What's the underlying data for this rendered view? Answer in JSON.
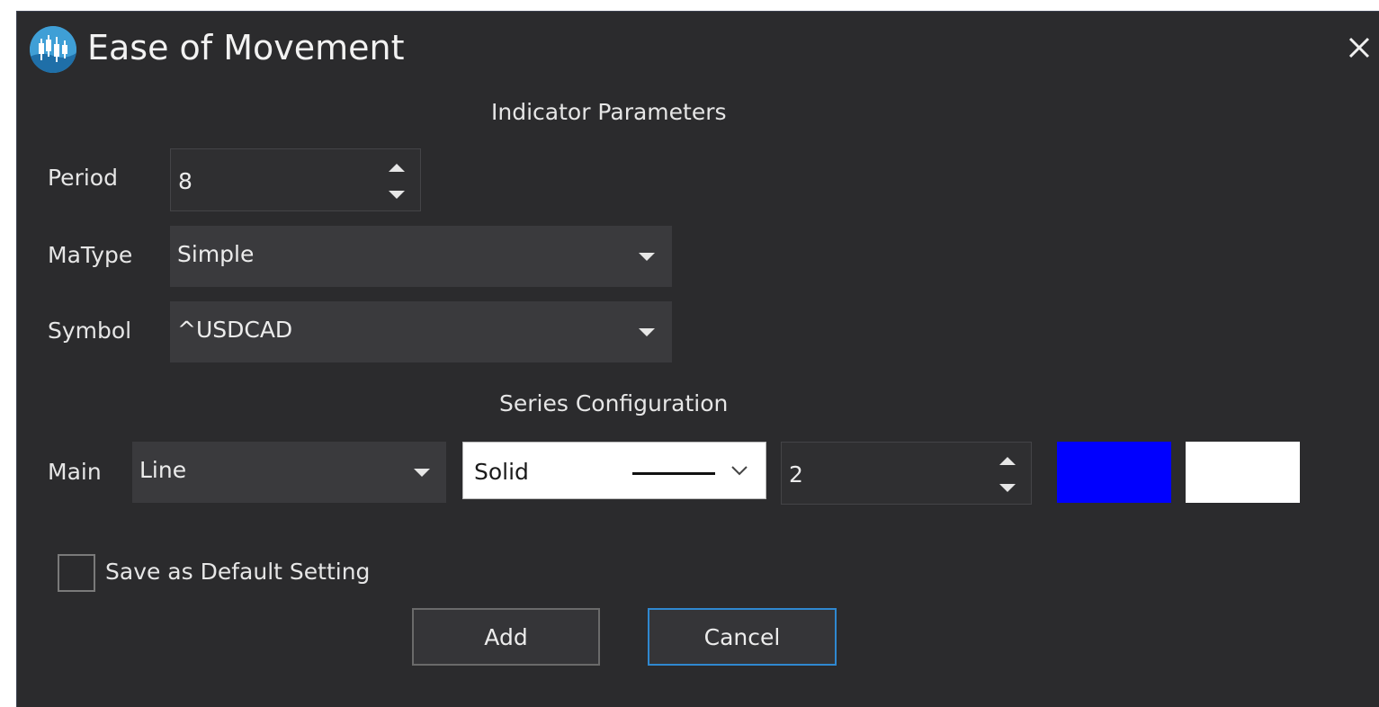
{
  "window": {
    "title": "Ease of Movement",
    "app_icon": "candlestick-chart-icon",
    "close_icon": "close-icon"
  },
  "indicator_parameters": {
    "heading": "Indicator Parameters",
    "period": {
      "label": "Period",
      "value": "8"
    },
    "ma_type": {
      "label": "MaType",
      "value": "Simple"
    },
    "symbol": {
      "label": "Symbol",
      "value": "^USDCAD"
    }
  },
  "series_configuration": {
    "heading": "Series Configuration",
    "main": {
      "label": "Main",
      "series_type": "Line",
      "line_style": "Solid",
      "line_width": "2",
      "color_primary": "#0000ff",
      "color_secondary": "#ffffff"
    }
  },
  "save_default": {
    "label": "Save as Default Setting",
    "checked": false
  },
  "buttons": {
    "add": "Add",
    "cancel": "Cancel"
  },
  "colors": {
    "dialog_bg": "#2b2b2d",
    "field_bg": "#3a3a3d",
    "accent_border": "#2f88d0"
  }
}
